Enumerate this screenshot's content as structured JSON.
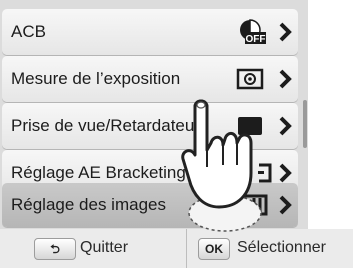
{
  "menu": {
    "items": [
      {
        "label": "ACB",
        "icon": "acb-off-icon"
      },
      {
        "label": "Mesure de l’exposition",
        "icon": "metering-icon"
      },
      {
        "label": "Prise de vue/Retardateur",
        "icon": "drive-mode-icon"
      },
      {
        "label": "Réglage AE Bracketing",
        "icon": "ae-bracket-icon"
      },
      {
        "label": "Réglage des images",
        "icon": "picture-wizard-icon"
      }
    ],
    "selected_index": 4
  },
  "footer": {
    "back_key": "⮌",
    "quit_label": "Quitter",
    "ok_key": "OK",
    "select_label": "Sélectionner"
  },
  "colors": {
    "screen_bg": "#dcdcdc",
    "item_bg": "#efefef",
    "selected_bg": "#bdbdbd",
    "bar_bg": "#ebebeb"
  }
}
